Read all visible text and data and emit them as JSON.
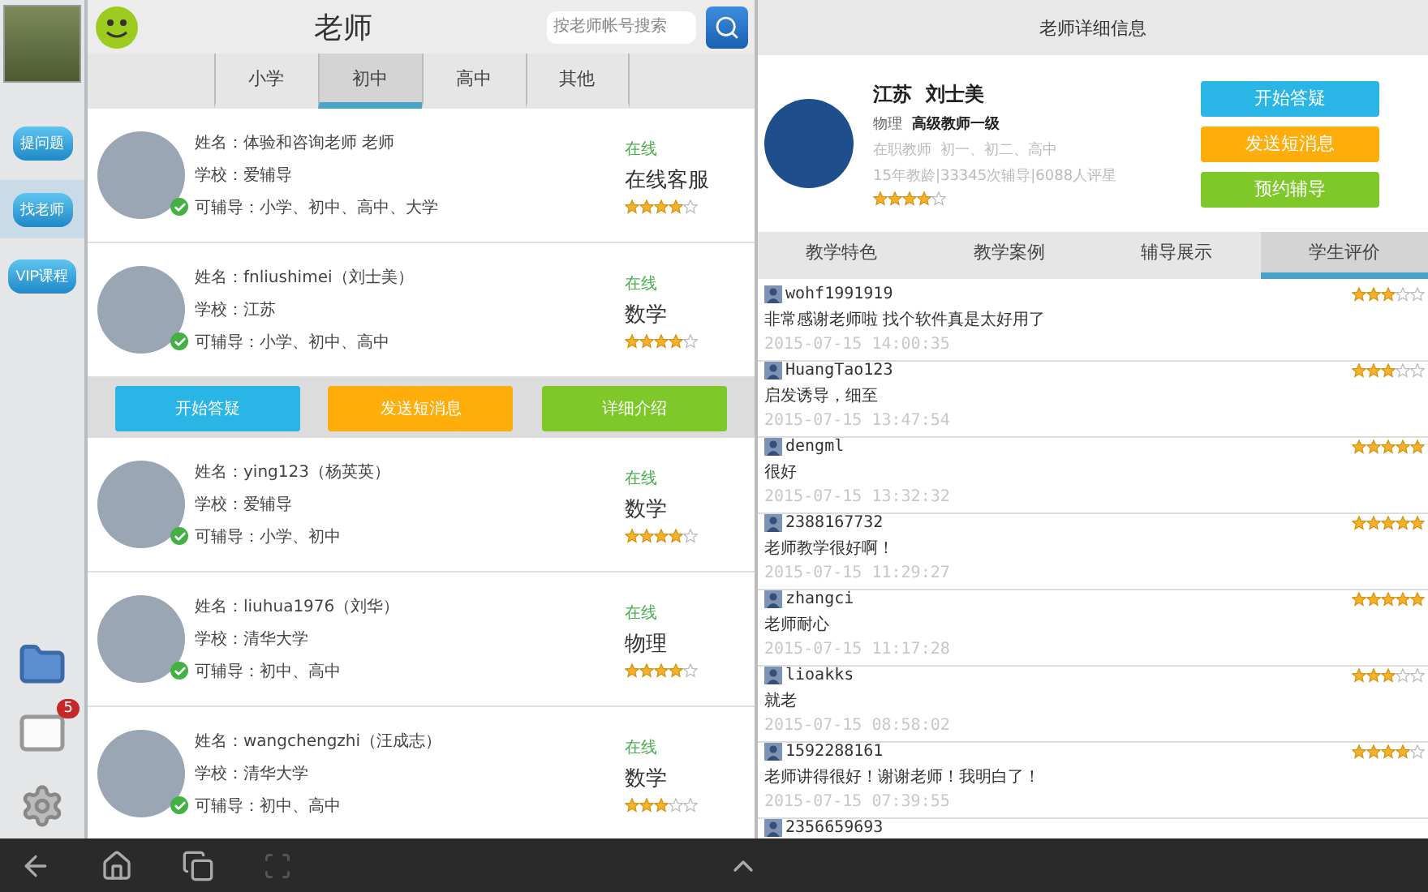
{
  "sidebar": {
    "items": [
      {
        "label": "提问题",
        "selected": false
      },
      {
        "label": "找老师",
        "selected": true
      },
      {
        "label": "VIP课程",
        "selected": false
      }
    ],
    "mail_badge": "5"
  },
  "teachers_panel": {
    "title": "老师",
    "search": {
      "placeholder": "按老师帐号搜索"
    },
    "tabs": [
      {
        "label": "小学",
        "selected": false
      },
      {
        "label": "初中",
        "selected": true
      },
      {
        "label": "高中",
        "selected": false
      },
      {
        "label": "其他",
        "selected": false
      }
    ],
    "teachers": [
      {
        "name": "姓名：体验和咨询老师 老师",
        "school": "学校：爱辅导",
        "grades": "可辅导：小学、初中、高中、大学",
        "status": "在线",
        "subject": "在线客服",
        "stars": 4,
        "expanded": false
      },
      {
        "name": "姓名：fnliushimei（刘士美）",
        "school": "学校：江苏",
        "grades": "可辅导：小学、初中、高中",
        "status": "在线",
        "subject": "数学",
        "stars": 4,
        "expanded": true
      },
      {
        "name": "姓名：ying123（杨英英）",
        "school": "学校：爱辅导",
        "grades": "可辅导：小学、初中",
        "status": "在线",
        "subject": "数学",
        "stars": 4,
        "expanded": false
      },
      {
        "name": "姓名：liuhua1976（刘华）",
        "school": "学校：清华大学",
        "grades": "可辅导：初中、高中",
        "status": "在线",
        "subject": "物理",
        "stars": 4,
        "expanded": false
      },
      {
        "name": "姓名：wangchengzhi（汪成志）",
        "school": "学校：清华大学",
        "grades": "可辅导：初中、高中",
        "status": "在线",
        "subject": "数学",
        "stars": 3,
        "expanded": false
      }
    ],
    "row_actions": [
      {
        "label": "开始答疑",
        "color": "#29b6e6"
      },
      {
        "label": "发送短消息",
        "color": "#ffad0a"
      },
      {
        "label": "详细介绍",
        "color": "#7ec82a"
      }
    ]
  },
  "detail_panel": {
    "title": "老师详细信息",
    "name": "江苏  刘士美",
    "subject": "物理",
    "rank": "高级教师一级",
    "position": "在职教师  初一、初二、高中",
    "stats": "15年教龄|33345次辅导|6088人评星",
    "stars": 4,
    "actions": [
      {
        "label": "开始答疑",
        "color": "#29b6e6"
      },
      {
        "label": "发送短消息",
        "color": "#ffad0a"
      },
      {
        "label": "预约辅导",
        "color": "#7ec82a"
      }
    ],
    "tabs": [
      {
        "label": "教学特色",
        "selected": false
      },
      {
        "label": "教学案例",
        "selected": false
      },
      {
        "label": "辅导展示",
        "selected": false
      },
      {
        "label": "学生评价",
        "selected": true
      }
    ],
    "reviews": [
      {
        "user": "wohf1991919",
        "stars": 3,
        "comment": "非常感谢老师啦 找个软件真是太好用了",
        "time": "2015-07-15 14:00:35"
      },
      {
        "user": "HuangTao123",
        "stars": 3,
        "comment": "启发诱导，细至",
        "time": "2015-07-15 13:47:54"
      },
      {
        "user": "dengml",
        "stars": 5,
        "comment": "很好",
        "time": "2015-07-15 13:32:32"
      },
      {
        "user": "2388167732",
        "stars": 5,
        "comment": "老师教学很好啊！",
        "time": "2015-07-15 11:29:27"
      },
      {
        "user": "zhangci",
        "stars": 5,
        "comment": "老师耐心",
        "time": "2015-07-15 11:17:28"
      },
      {
        "user": "lioakks",
        "stars": 3,
        "comment": "就老",
        "time": "2015-07-15 08:58:02"
      },
      {
        "user": "1592288161",
        "stars": 4,
        "comment": "老师讲得很好！谢谢老师！我明白了！",
        "time": "2015-07-15 07:39:55"
      },
      {
        "user": "2356659693"
      }
    ]
  }
}
